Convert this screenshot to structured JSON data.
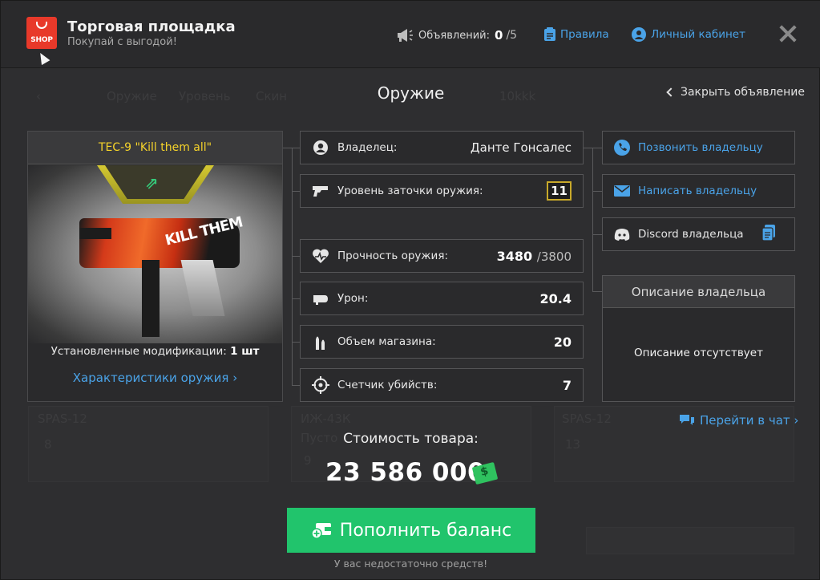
{
  "header": {
    "logo_text": "SHOP",
    "title": "Торговая площадка",
    "subtitle": "Покупай с выгодой!",
    "ads_label": "Объявлений:",
    "ads_count": "0",
    "ads_max": "/5",
    "rules_label": "Правила",
    "cabinet_label": "Личный кабинет"
  },
  "background_ghost": {
    "tabs": [
      "Оружие",
      "Уровень",
      "Скин",
      "10kkk"
    ],
    "cards": [
      "SPAS-12",
      "ИЖ-43К",
      "Пусто",
      "SPAS-12",
      "8",
      "9",
      "13"
    ]
  },
  "section": {
    "title": "Оружие",
    "close_ad_label": "Закрыть объявление"
  },
  "weapon": {
    "name": "TEC-9 \"Kill them all\"",
    "graffiti": "KILL THEM",
    "mods_label": "Установленные модификации:",
    "mods_value": "1 шт",
    "characteristics_link": "Характеристики оружия ›"
  },
  "stats": {
    "owner_label": "Владелец:",
    "owner_value": "Данте Гонсалес",
    "upgrade_label": "Уровень заточки оружия:",
    "upgrade_value": "11",
    "durability_label": "Прочность оружия:",
    "durability_value": "3480",
    "durability_max": "/3800",
    "damage_label": "Урон:",
    "damage_value": "20.4",
    "magazine_label": "Объем магазина:",
    "magazine_value": "20",
    "kills_label": "Счетчик убийств:",
    "kills_value": "7"
  },
  "actions": {
    "call_label": "Позвонить владельцу",
    "write_label": "Написать владельцу",
    "discord_label": "Discord владельца",
    "description_title": "Описание владельца",
    "description_text": "Описание отсутствует",
    "chat_link": "Перейти в чат ›"
  },
  "purchase": {
    "price_label": "Стоимость товара:",
    "price_value": "23 586 000",
    "topup_label": "Пополнить баланс",
    "insufficient_note": "У вас недостаточно средств!"
  },
  "colors": {
    "accent_blue": "#4aa3e8",
    "topup_green": "#21c46c",
    "weapon_name_yellow": "#f5d32a",
    "shop_red": "#e8392a"
  },
  "icons": [
    "megaphone-icon",
    "rules-doc-icon",
    "user-icon",
    "close-icon",
    "chevron-left-icon",
    "user-circle-icon",
    "gun-icon",
    "heartbeat-icon",
    "bullet-icon",
    "ammo-icon",
    "crosshair-icon",
    "phone-icon",
    "mail-icon",
    "discord-icon",
    "copy-icon",
    "chat-icon",
    "money-icon",
    "wallet-add-icon"
  ]
}
